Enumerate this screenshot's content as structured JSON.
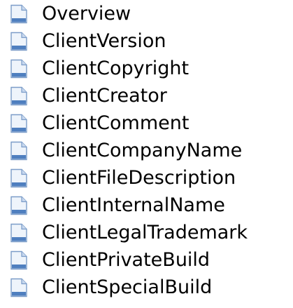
{
  "topics": [
    {
      "label": "Overview",
      "icon": "document-icon"
    },
    {
      "label": "ClientVersion",
      "icon": "document-icon"
    },
    {
      "label": "ClientCopyright",
      "icon": "document-icon"
    },
    {
      "label": "ClientCreator",
      "icon": "document-icon"
    },
    {
      "label": "ClientComment",
      "icon": "document-icon"
    },
    {
      "label": "ClientCompanyName",
      "icon": "document-icon"
    },
    {
      "label": "ClientFileDescription",
      "icon": "document-icon"
    },
    {
      "label": "ClientInternalName",
      "icon": "document-icon"
    },
    {
      "label": "ClientLegalTrademark",
      "icon": "document-icon"
    },
    {
      "label": "ClientPrivateBuild",
      "icon": "document-icon"
    },
    {
      "label": "ClientSpecialBuild",
      "icon": "document-icon"
    }
  ],
  "colors": {
    "icon_page": "#eef4fb",
    "icon_border": "#7b9cc8",
    "icon_fold": "#c9d9ef",
    "icon_band": "#4f7fbf",
    "text": "#000000",
    "background": "#ffffff"
  }
}
